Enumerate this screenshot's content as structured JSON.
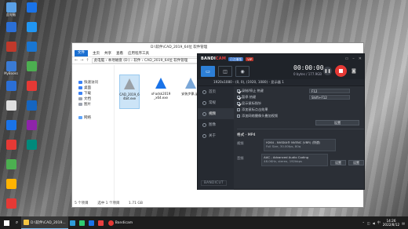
{
  "desktop": {
    "icons_col1": [
      {
        "label": "此电脑",
        "color": "#5aa0e6"
      },
      {
        "label": "",
        "color": "#2b6fd6"
      },
      {
        "label": "",
        "color": "#c0392b"
      },
      {
        "label": "MyBooks",
        "color": "#3a7bd5"
      },
      {
        "label": "",
        "color": "#2b6fd6"
      },
      {
        "label": "",
        "color": "#e0e0e0"
      },
      {
        "label": "",
        "color": "#1a73e8"
      },
      {
        "label": "",
        "color": "#e53935"
      },
      {
        "label": "",
        "color": "#4caf50"
      },
      {
        "label": "",
        "color": "#ffb300"
      },
      {
        "label": "",
        "color": "#e53935"
      }
    ],
    "icons_col2": [
      {
        "label": "",
        "color": "#1a73e8"
      },
      {
        "label": "",
        "color": "#2196f3"
      },
      {
        "label": "",
        "color": "#1976d2"
      },
      {
        "label": "",
        "color": "#4caf50"
      },
      {
        "label": "",
        "color": "#e53935"
      },
      {
        "label": "",
        "color": "#1565c0"
      },
      {
        "label": "",
        "color": "#8e24aa"
      },
      {
        "label": "",
        "color": "#00897b"
      }
    ]
  },
  "explorer": {
    "title": "D:\\软件\\CAD_2019_64位 软件管理",
    "tabs": {
      "file": "文件",
      "home": "主页",
      "share": "共享",
      "view": "查看",
      "manage": "应用程序工具"
    },
    "path": "此电脑 › 本地磁盘 (D:) › 软件 › CAD_2019_64位 软件管理",
    "sidebar": [
      {
        "label": "快速访问",
        "color": "#3b82f6"
      },
      {
        "label": "桌面",
        "color": "#3b82f6"
      },
      {
        "label": "下载",
        "color": "#3b82f6"
      },
      {
        "label": "文档",
        "color": "#9ca3af"
      },
      {
        "label": "图片",
        "color": "#9ca3af"
      },
      {
        "label": "网络",
        "color": "#60a5fa"
      }
    ],
    "files": [
      {
        "name": "CAD_2019_64bit.exe",
        "selected": true,
        "color": "#9aa0a6"
      },
      {
        "name": "xf-adsk2019_x64.exe",
        "selected": false,
        "color": "#1a73e8"
      },
      {
        "name": "安装步骤.jpg",
        "selected": false,
        "color": "#7aa7d8"
      }
    ],
    "status": {
      "count": "5 个项目",
      "selected": "选中 1 个项目",
      "size": "1.71 GB"
    }
  },
  "bandicam": {
    "logo_a": "BANDI",
    "logo_b": "CAM",
    "badge_reg": "已注册版",
    "badge_vip": "VIP",
    "timer": "00:00:00",
    "size": "0 bytes / 177.9GB",
    "info": "1920x1080 - (0, 0), (1920, 1080) - 显示器 1",
    "nav": [
      {
        "label": "首页",
        "active": false
      },
      {
        "label": "常规",
        "active": false
      },
      {
        "label": "视频",
        "active": true
      },
      {
        "label": "图像",
        "active": false
      },
      {
        "label": "关于",
        "active": false
      }
    ],
    "options": [
      {
        "label": "录制/停止 热键",
        "checked": true,
        "value": "F12"
      },
      {
        "label": "暂停 热键",
        "checked": true,
        "value": "Shift+F12"
      },
      {
        "label": "显示鼠标指针",
        "checked": true,
        "value": ""
      },
      {
        "label": "添加鼠标点击效果",
        "checked": false,
        "value": ""
      },
      {
        "label": "添加网络摄像头叠加视频",
        "checked": false,
        "value": ""
      }
    ],
    "settings_btn": "设置",
    "format_title": "格式 - MP4",
    "video_label": "视频",
    "video_codec": "H264 - NVIDIA® NVENC (VBR) (快速)",
    "video_detail": "Full Size, 30.00fps, 80q",
    "audio_label": "音频",
    "audio_codec": "AAC - Advanced Audio Coding",
    "audio_detail": "48.0KHz, stereo, 192kbps",
    "preset_btn": "设置",
    "settings_btn2": "设置",
    "footer": "BANDICUT"
  },
  "taskbar": {
    "explorer_task": "D:\\软件\\CAD_2019...",
    "bandicam_task": "Bandicam",
    "time": "14:26",
    "date": "2022/8/12",
    "lang": "中"
  }
}
